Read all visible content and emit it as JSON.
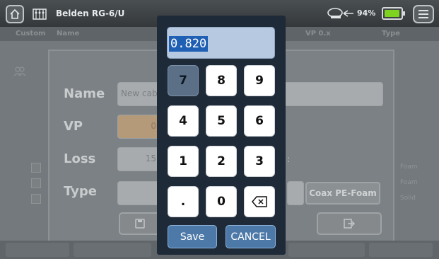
{
  "header": {
    "title": "Belden RG-6/U",
    "battery_percent": "94%",
    "battery_level": 0.94
  },
  "icons": {
    "home": "home-icon",
    "device": "device-icon",
    "battery_probe": "probe-icon",
    "menu": "hamburger-menu-icon"
  },
  "table": {
    "columns": [
      "Custom",
      "Name",
      "VP 0.x",
      "Type"
    ],
    "rows_right": [
      "Foam",
      "Foam",
      "Solid"
    ]
  },
  "dialog": {
    "labels": {
      "name": "Name",
      "vp": "VP",
      "loss": "Loss",
      "type": "Type"
    },
    "name_value": "New cab",
    "vp_value": "0",
    "loss_value": "15",
    "loss_suffix": ":",
    "type_option": "Coax PE-Foam"
  },
  "keypad": {
    "display_value": "0.820",
    "keys": [
      "7",
      "8",
      "9",
      "4",
      "5",
      "6",
      "1",
      "2",
      "3",
      ".",
      "0"
    ],
    "save_label": "Save",
    "cancel_label": "CANCEL"
  },
  "colors": {
    "keypad_bg": "#1f2a38",
    "accent": "#4d79a8",
    "selection": "#1f5fb4",
    "battery": "#7ed321"
  }
}
